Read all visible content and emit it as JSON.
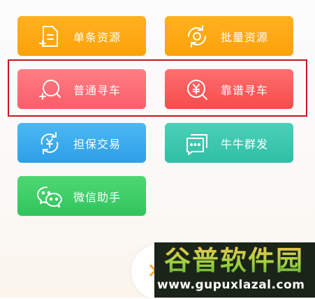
{
  "menu": {
    "single_resource": "单条资源",
    "batch_resource": "批量资源",
    "normal_search": "普通寻车",
    "reliable_search": "靠谱寻车",
    "escrow_trade": "担保交易",
    "group_send": "牛牛群发",
    "wechat_helper": "微信助手"
  },
  "watermark": {
    "brand": "谷普软件园",
    "url": "www.gupuxlazal.com"
  },
  "colors": {
    "orange": "#fca20a",
    "red": "#fb5d6a",
    "blue": "#2e9fe8",
    "teal": "#2fbfa5",
    "green": "#31c45c",
    "highlight_border": "#c9141c"
  }
}
